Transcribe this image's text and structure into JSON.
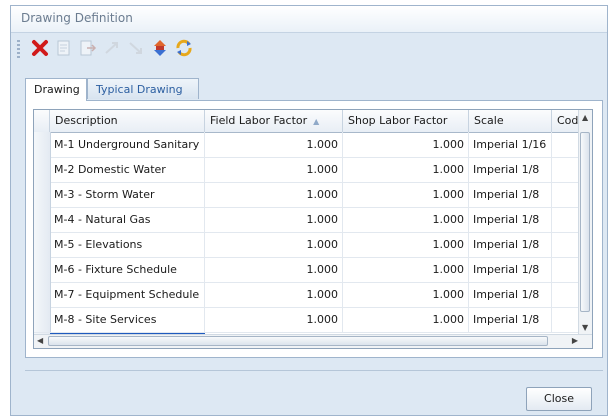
{
  "window": {
    "title": "Drawing Definition"
  },
  "toolbar": {
    "buttons": [
      {
        "name": "delete-icon",
        "enabled": true
      },
      {
        "name": "document-icon",
        "enabled": false
      },
      {
        "name": "export-icon",
        "enabled": false
      },
      {
        "name": "move-icon",
        "enabled": false
      },
      {
        "name": "move-down-icon",
        "enabled": false
      },
      {
        "name": "reorder-icon",
        "enabled": true
      },
      {
        "name": "refresh-icon",
        "enabled": true
      }
    ]
  },
  "tabs": [
    {
      "label": "Drawing",
      "active": true
    },
    {
      "label": "Typical Drawing",
      "active": false
    }
  ],
  "grid": {
    "columns": [
      "Description",
      "Field Labor Factor",
      "Shop Labor Factor",
      "Scale",
      "Code"
    ],
    "sorted_column": "Field Labor Factor",
    "sort_direction": "ascending",
    "rows": [
      {
        "description": "M-1 Underground Sanitary",
        "field": "1.000",
        "shop": "1.000",
        "scale": "Imperial 1/16"
      },
      {
        "description": "M-2 Domestic Water",
        "field": "1.000",
        "shop": "1.000",
        "scale": "Imperial 1/8"
      },
      {
        "description": "M-3 - Storm Water",
        "field": "1.000",
        "shop": "1.000",
        "scale": "Imperial 1/8"
      },
      {
        "description": "M-4 - Natural Gas",
        "field": "1.000",
        "shop": "1.000",
        "scale": "Imperial 1/8"
      },
      {
        "description": "M-5 - Elevations",
        "field": "1.000",
        "shop": "1.000",
        "scale": "Imperial 1/8"
      },
      {
        "description": "M-6 - Fixture Schedule",
        "field": "1.000",
        "shop": "1.000",
        "scale": "Imperial 1/8"
      },
      {
        "description": "M-7 - Equipment Schedule",
        "field": "1.000",
        "shop": "1.000",
        "scale": "Imperial 1/8"
      },
      {
        "description": "M-8 - Site Services",
        "field": "1.000",
        "shop": "1.000",
        "scale": "Imperial 1/8"
      }
    ]
  },
  "buttons": {
    "close": "Close"
  },
  "colors": {
    "selection": "#1f5bbf",
    "delete": "#d11a1a",
    "window_bg": "#dde8f3"
  }
}
